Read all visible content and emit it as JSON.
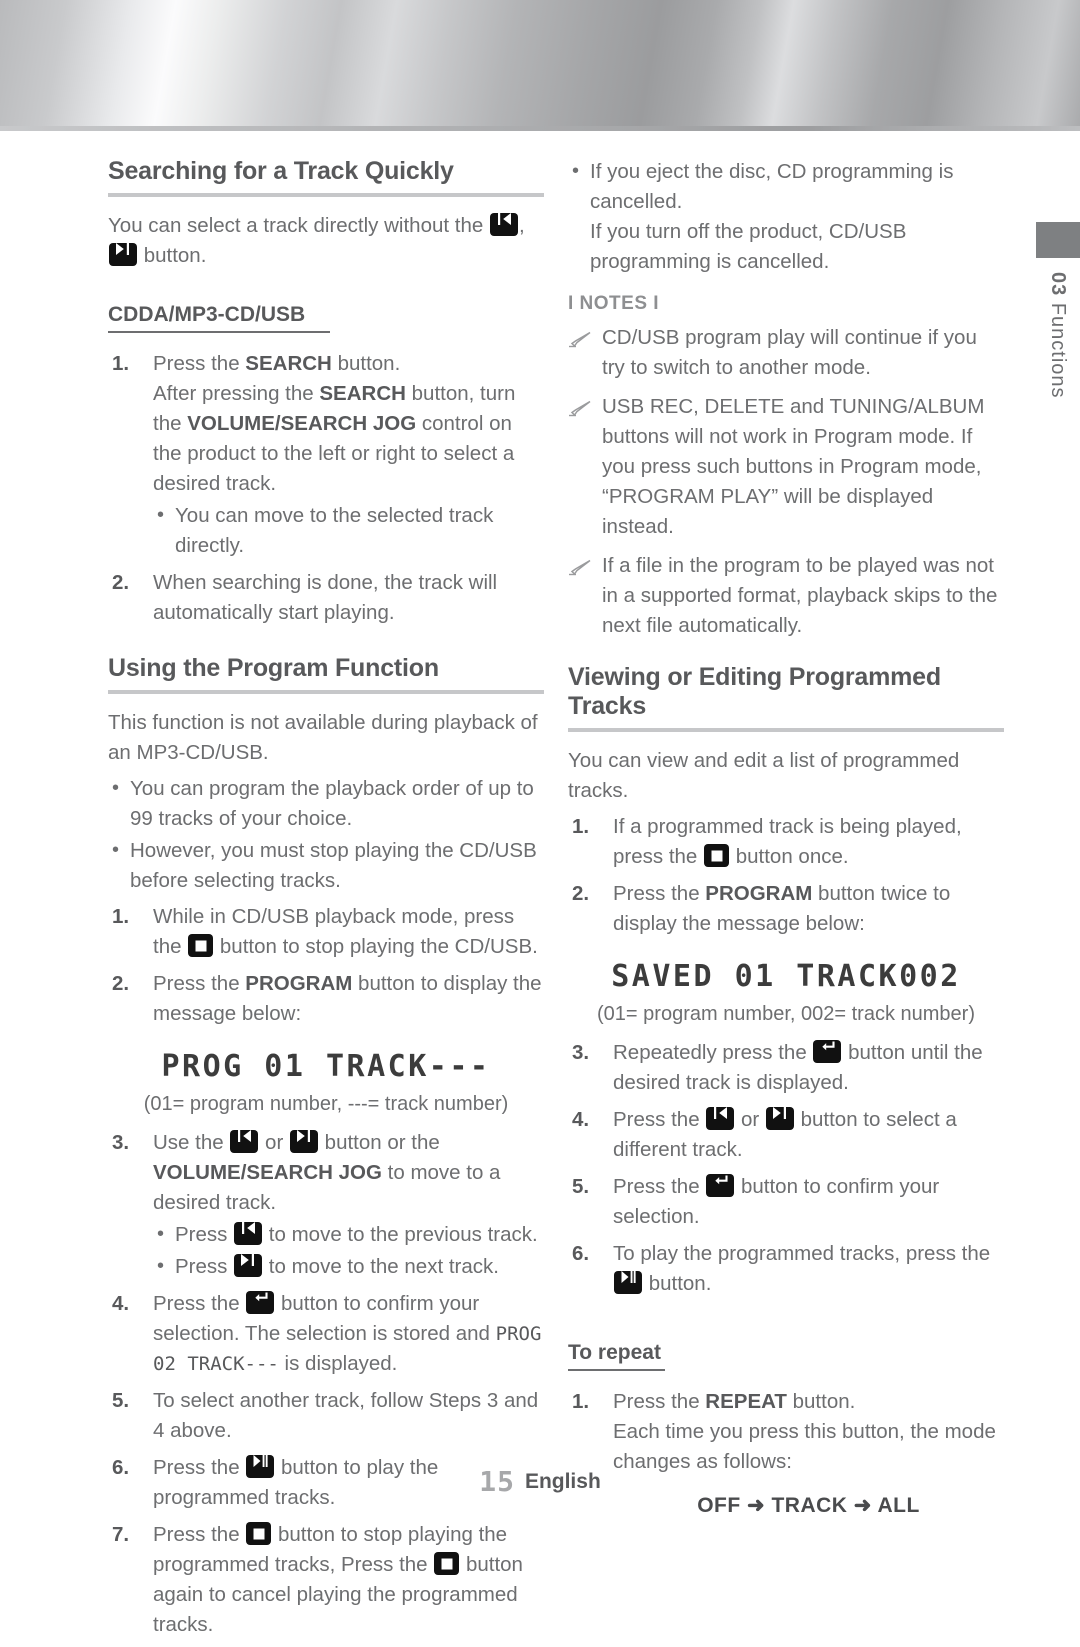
{
  "page": {
    "number": "15",
    "language": "English",
    "side_tab": {
      "chapter_number": "03",
      "chapter_title": "Functions"
    }
  },
  "left_column": {
    "section1": {
      "heading": "Searching for a Track Quickly",
      "intro_a": "You can select a track directly without the ",
      "intro_b": ", ",
      "intro_c": " button.",
      "subheading": "CDDA/MP3-CD/USB",
      "steps": [
        {
          "n": "1.",
          "text_1": "Press the ",
          "bold_1": "SEARCH",
          "text_2": " button.",
          "text_3": "After pressing the ",
          "bold_2": "SEARCH",
          "text_4": " button, turn the ",
          "bold_3": "VOLUME/SEARCH JOG",
          "text_5": " control on the product to the left or right to select a desired track.",
          "bullets": [
            "You can move to the selected track directly."
          ]
        },
        {
          "n": "2.",
          "text_1": "When searching is done, the track will automatically start playing."
        }
      ]
    },
    "section2": {
      "heading": "Using the Program Function",
      "intro": "This function is not available during playback of an MP3-CD/USB.",
      "bullets": [
        "You can program the playback order of up to 99 tracks of your choice.",
        "However, you must stop playing the CD/USB before selecting tracks."
      ],
      "steps": [
        {
          "n": "1.",
          "text_1": "While in CD/USB playback mode, press the ",
          "text_2": " button to stop playing the CD/USB."
        },
        {
          "n": "2.",
          "text_1": "Press the ",
          "bold_1": "PROGRAM",
          "text_2": " button to display the message below:"
        }
      ],
      "lcd_display": "PROG 01 TRACK---",
      "lcd_caption": "(01= program number, ---= track number)",
      "steps_cont": [
        {
          "n": "3.",
          "text_1": "Use the ",
          "text_2": " or ",
          "text_3": " button or the ",
          "bold_1": "VOLUME/SEARCH JOG",
          "text_4": " to move to a desired track.",
          "bullet_a1": "Press ",
          "bullet_a2": " to move to the previous track.",
          "bullet_b1": "Press ",
          "bullet_b2": " to move to the next track."
        },
        {
          "n": "4.",
          "text_1": "Press the ",
          "text_2": " button to confirm your selection. The selection is stored and ",
          "lcd": "PROG 02 TRACK---",
          "text_3": " is displayed."
        },
        {
          "n": "5.",
          "text_1": "To select another track, follow Steps 3 and 4 above."
        },
        {
          "n": "6.",
          "text_1": "Press the ",
          "text_2": " button to play the programmed tracks."
        },
        {
          "n": "7.",
          "text_1": "Press the ",
          "text_2": " button to stop playing the programmed tracks, Press the ",
          "text_3": " button again to cancel playing the programmed tracks."
        }
      ]
    }
  },
  "right_column": {
    "top_bullet": {
      "line_1": "If you eject the disc, CD programming is cancelled.",
      "line_2": "If you turn off the product, CD/USB programming is cancelled."
    },
    "notes": {
      "title": "I NOTES I",
      "items": [
        "CD/USB program play will continue if you try to switch to another mode.",
        "USB REC, DELETE and TUNING/ALBUM buttons will not work in Program mode. If you press such buttons in Program mode, “PROGRAM PLAY” will be displayed instead.",
        "If a file in the program to be played was not in a supported format, playback skips to the next file automatically."
      ]
    },
    "section3": {
      "heading": "Viewing or Editing Programmed Tracks",
      "intro": "You can view and edit a list of programmed tracks.",
      "steps": [
        {
          "n": "1.",
          "text_1": "If a programmed track is being played, press the ",
          "text_2": " button once."
        },
        {
          "n": "2.",
          "text_1": "Press the ",
          "bold_1": "PROGRAM",
          "text_2": " button twice to display the message below:"
        }
      ],
      "lcd_display": "SAVED 01 TRACK002",
      "lcd_caption": "(01= program number, 002= track number)",
      "steps_cont": [
        {
          "n": "3.",
          "text_1": "Repeatedly press the ",
          "text_2": " button until the desired track is displayed."
        },
        {
          "n": "4.",
          "text_1": "Press the ",
          "text_2": " or ",
          "text_3": " button to select a different track."
        },
        {
          "n": "5.",
          "text_1": "Press the ",
          "text_2": " button to confirm your selection."
        },
        {
          "n": "6.",
          "text_1": "To play the programmed tracks, press the ",
          "text_2": " button."
        }
      ]
    },
    "section4": {
      "heading": "To repeat",
      "steps": [
        {
          "n": "1.",
          "text_1": "Press the ",
          "bold_1": "REPEAT",
          "text_2": " button.",
          "text_3": "Each time you press this button, the mode changes as follows:"
        }
      ],
      "repeat_sequence": "OFF ➜ TRACK ➜ ALL"
    }
  },
  "icons": {
    "prev": "prev-track-icon",
    "next": "next-track-icon",
    "stop": "stop-icon",
    "play_pause": "play-pause-icon",
    "enter": "enter-icon",
    "note": "pencil-icon"
  },
  "colors": {
    "body_text": "#6d6e70",
    "heading_text": "#58595b",
    "rule_thick": "#c6c7c9",
    "icon_bg": "#111111",
    "tab_swatch": "#7e8082"
  }
}
